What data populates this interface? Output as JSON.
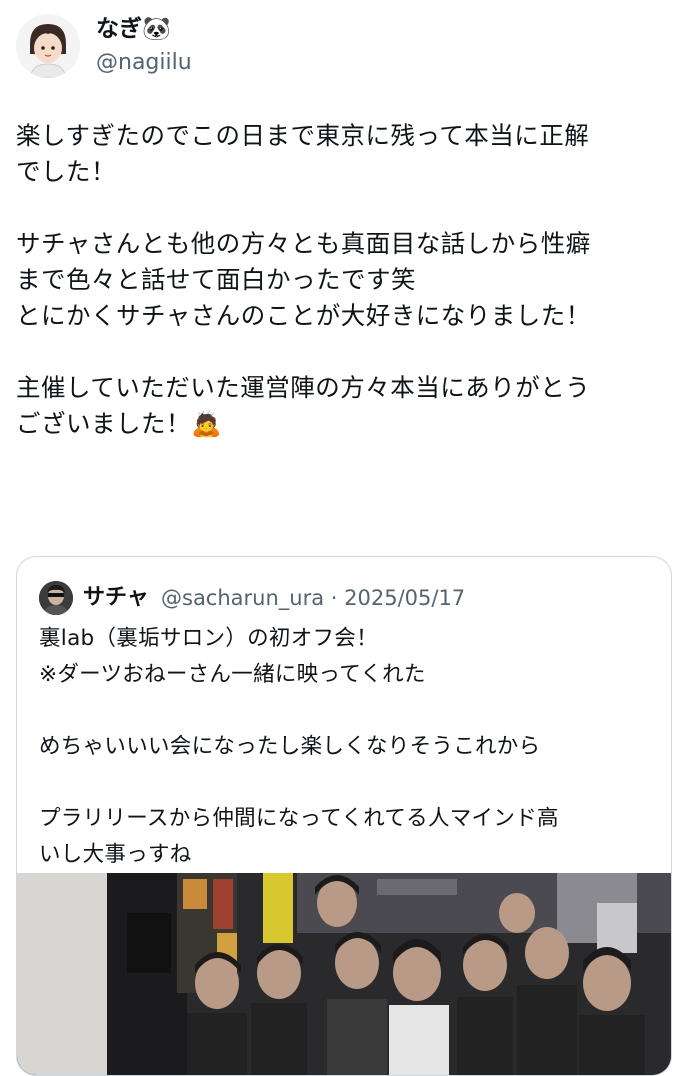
{
  "author": {
    "display_name": "なぎ🐼",
    "handle": "@nagiilu",
    "avatar_icon": "person-avatar-icon"
  },
  "tweet": {
    "text": "楽しすぎたのでこの日まで東京に残って本当に正解\nでした！\n\nサチャさんとも他の方々とも真面目な話しから性癖\nまで色々と話せて面白かったです笑\nとにかくサチャさんのことが大好きになりました！\n\n主催していただいた運営陣の方々本当にありがとう\nございました！🙇"
  },
  "quote": {
    "display_name": "サチャ",
    "handle_date": "@sacharun_ura · 2025/05/17",
    "avatar_icon": "person-avatar-icon",
    "text": "裏lab（裏垢サロン）の初オフ会！\n※ダーツおねーさん一緒に映ってくれた\n\nめちゃいいい会になったし楽しくなりそうこれから\n\nプラリリースから仲間になってくれてる人マインド高\nいし大事っすね",
    "photo_icon": "group-photo-image"
  },
  "colors": {
    "text": "#0f1419",
    "secondary": "#536471",
    "border": "#cfd9de",
    "background": "#ffffff"
  }
}
